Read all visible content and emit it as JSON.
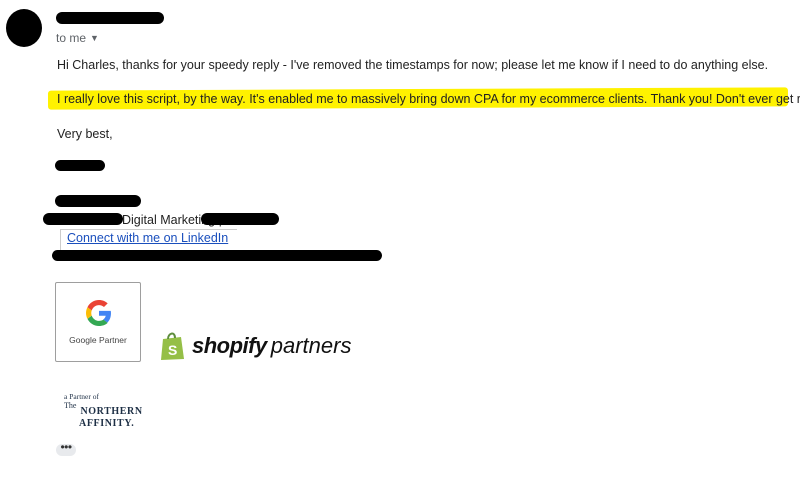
{
  "header": {
    "to_label": "to me"
  },
  "message": {
    "line1": "Hi Charles, thanks for your speedy reply - I've removed the timestamps for now; please let me know if I need to do anything else.",
    "highlight": "I really love this script, by the way. It's enabled me to massively bring down CPA for my ecommerce clients. Thank you! Don't ever get rid of it!",
    "closing": "Very best,"
  },
  "signature": {
    "title_suffix": "Digital Marketing |",
    "linkedin_label": "Connect with me on LinkedIn",
    "google_partner_label": "Google Partner",
    "shopify_word": "shopify",
    "partners_word": "partners",
    "northern_affinity": {
      "small": "a Partner of",
      "the": "The",
      "line1": "NORTHERN",
      "line2": "AFFINITY."
    }
  },
  "more_label": "•••",
  "colors": {
    "highlight": "#fff200",
    "link": "#1a4fbd",
    "shopify_green": "#95bf47"
  },
  "icons": [
    "caret-down-icon",
    "google-g-icon",
    "shopify-bag-icon",
    "more-icon"
  ]
}
